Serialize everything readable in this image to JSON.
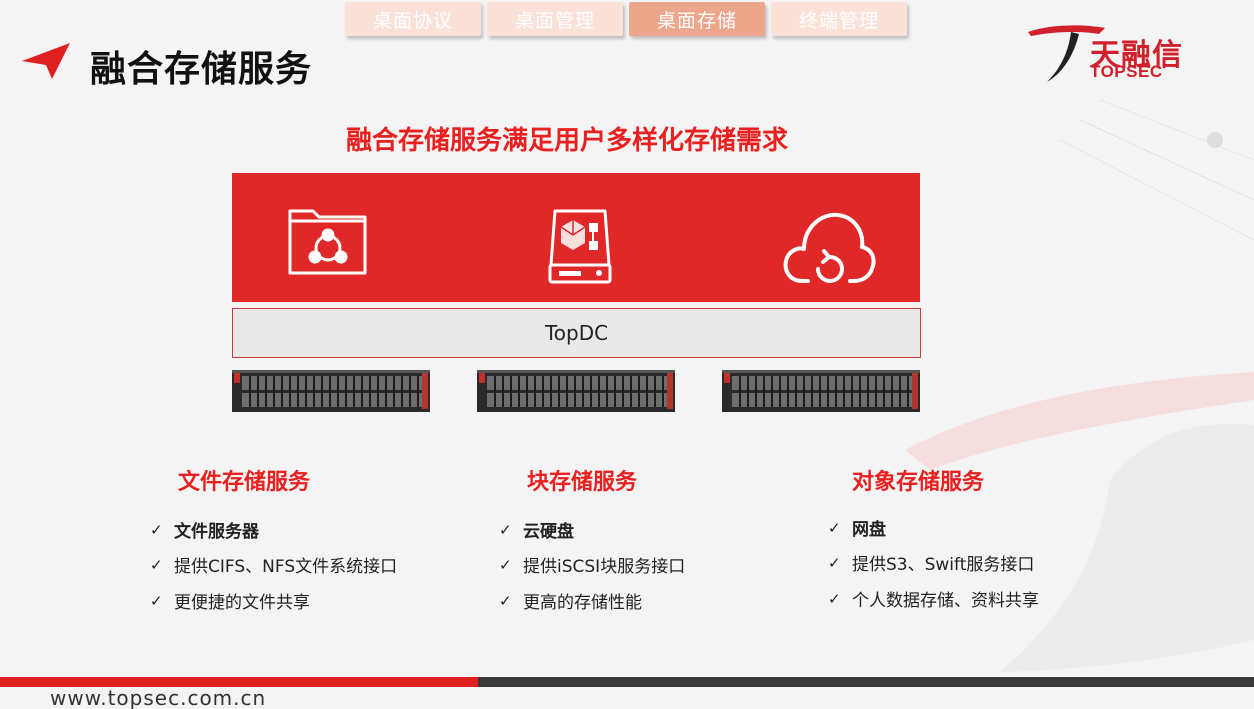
{
  "nav": {
    "tabs": [
      {
        "label": "桌面协议",
        "active": false
      },
      {
        "label": "桌面管理",
        "active": false
      },
      {
        "label": "桌面存储",
        "active": true
      },
      {
        "label": "终端管理",
        "active": false
      }
    ]
  },
  "header": {
    "title": "融合存储服务",
    "logo_cn": "天融信",
    "logo_en": "TOPSEC"
  },
  "headline": "融合存储服务满足用户多样化存储需求",
  "panel": {
    "icons": [
      "folder-share-icon",
      "block-storage-icon",
      "cloud-upload-icon"
    ],
    "platform": "TopDC"
  },
  "columns": [
    {
      "title": "文件存储服务",
      "items": [
        "文件服务器",
        "提供CIFS、NFS文件系统接口",
        "更便捷的文件共享"
      ]
    },
    {
      "title": "块存储服务",
      "items": [
        "云硬盘",
        "提供iSCSI块服务接口",
        "更高的存储性能"
      ]
    },
    {
      "title": "对象存储服务",
      "items": [
        "网盘",
        "提供S3、Swift服务接口",
        "个人数据存储、资料共享"
      ]
    }
  ],
  "footer": {
    "url": "www.topsec.com.cn"
  },
  "colors": {
    "brand_red": "#e02828",
    "tab_inactive": "#fbe2d9",
    "tab_active": "#eda58c"
  }
}
